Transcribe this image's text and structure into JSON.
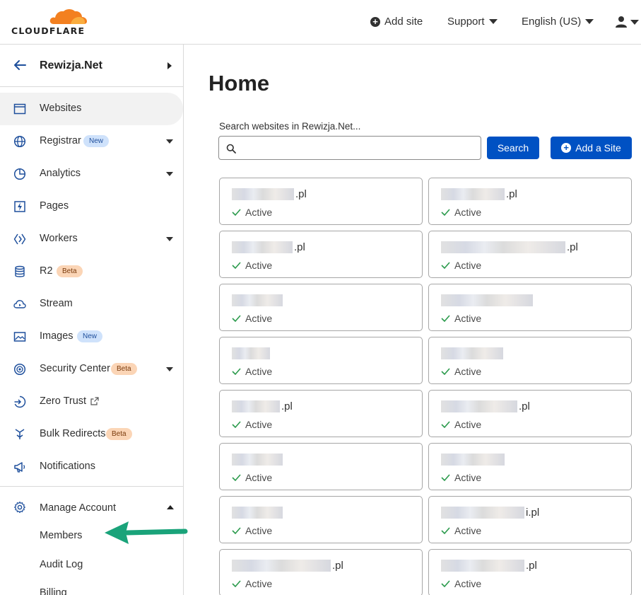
{
  "brand": {
    "name": "CLOUDFLARE",
    "cloud_color": "#f38020"
  },
  "topbar": {
    "add_site": "Add site",
    "support": "Support",
    "language": "English (US)"
  },
  "sidebar": {
    "account_name": "Rewizja.Net",
    "items": [
      {
        "label": "Websites",
        "icon": "browser-window-icon",
        "active": true
      },
      {
        "label": "Registrar",
        "icon": "globe-icon",
        "badge": "New",
        "badge_type": "new",
        "expandable": true
      },
      {
        "label": "Analytics",
        "icon": "pie-chart-icon",
        "expandable": true
      },
      {
        "label": "Pages",
        "icon": "lightning-page-icon"
      },
      {
        "label": "Workers",
        "icon": "workers-icon",
        "expandable": true
      },
      {
        "label": "R2",
        "icon": "database-icon",
        "badge": "Beta",
        "badge_type": "beta"
      },
      {
        "label": "Stream",
        "icon": "cloud-play-icon"
      },
      {
        "label": "Images",
        "icon": "image-icon",
        "badge": "New",
        "badge_type": "new"
      },
      {
        "label": "Security Center",
        "icon": "security-center-icon",
        "badge": "Beta",
        "badge_type": "beta",
        "expandable": true
      },
      {
        "label": "Zero Trust",
        "icon": "zero-trust-icon",
        "external": true
      },
      {
        "label": "Bulk Redirects",
        "icon": "bulk-redirects-icon",
        "badge": "Beta",
        "badge_type": "beta"
      },
      {
        "label": "Notifications",
        "icon": "megaphone-icon"
      }
    ],
    "manage_account": {
      "label": "Manage Account",
      "children": [
        "Members",
        "Audit Log",
        "Billing"
      ]
    }
  },
  "main": {
    "title": "Home",
    "search_label": "Search websites in Rewizja.Net...",
    "search_value": "",
    "search_button": "Search",
    "add_site_button": "Add a Site",
    "sites": [
      {
        "visible_suffix": ".pl",
        "status": "Active"
      },
      {
        "visible_suffix": ".pl",
        "status": "Active"
      },
      {
        "visible_suffix": ".pl",
        "status": "Active"
      },
      {
        "visible_suffix": ".pl",
        "status": "Active"
      },
      {
        "visible_suffix": "",
        "status": "Active"
      },
      {
        "visible_suffix": "",
        "status": "Active"
      },
      {
        "visible_suffix": "",
        "status": "Active"
      },
      {
        "visible_suffix": "",
        "status": "Active"
      },
      {
        "visible_suffix": ".pl",
        "status": "Active"
      },
      {
        "visible_suffix": ".pl",
        "status": "Active"
      },
      {
        "visible_suffix": "",
        "status": "Active"
      },
      {
        "visible_suffix": "",
        "status": "Active"
      },
      {
        "visible_suffix": "",
        "status": "Active"
      },
      {
        "visible_suffix": "i.pl",
        "status": "Active"
      },
      {
        "visible_suffix": ".pl",
        "status": "Active"
      },
      {
        "visible_suffix": ".pl",
        "status": "Active"
      }
    ],
    "status_color": "#2c9b4d"
  },
  "annotation": {
    "arrow_color": "#1aa37a"
  }
}
